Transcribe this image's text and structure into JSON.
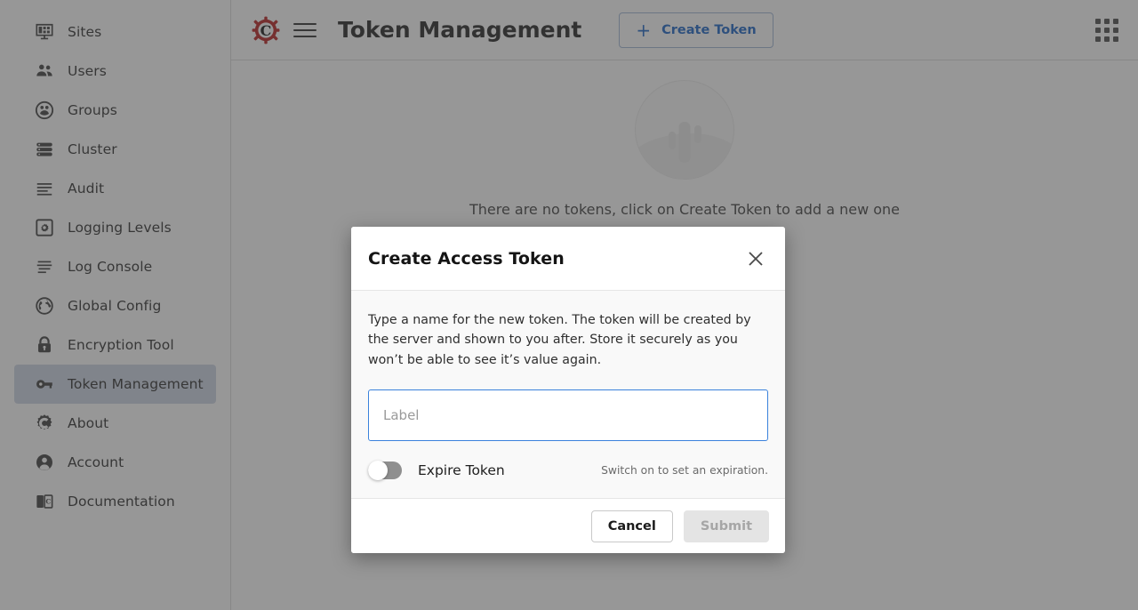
{
  "sidebar": {
    "items": [
      {
        "label": "Sites",
        "icon": "monitor-icon",
        "active": false
      },
      {
        "label": "Users",
        "icon": "users-icon",
        "active": false
      },
      {
        "label": "Groups",
        "icon": "groups-icon",
        "active": false
      },
      {
        "label": "Cluster",
        "icon": "server-stack-icon",
        "active": false
      },
      {
        "label": "Audit",
        "icon": "lines-icon",
        "active": false
      },
      {
        "label": "Logging Levels",
        "icon": "gear-square-icon",
        "active": false
      },
      {
        "label": "Log Console",
        "icon": "console-lines-icon",
        "active": false
      },
      {
        "label": "Global Config",
        "icon": "globe-icon",
        "active": false
      },
      {
        "label": "Encryption Tool",
        "icon": "lock-icon",
        "active": false
      },
      {
        "label": "Token Management",
        "icon": "key-icon",
        "active": true
      },
      {
        "label": "About",
        "icon": "gear-c-icon",
        "active": false
      },
      {
        "label": "Account",
        "icon": "person-icon",
        "active": false
      },
      {
        "label": "Documentation",
        "icon": "book-icon",
        "active": false
      }
    ]
  },
  "topbar": {
    "logo_icon": "gear-c-logo",
    "menu_icon": "hamburger-icon",
    "title": "Token Management",
    "create_button_label": "Create Token",
    "create_button_icon": "plus-icon",
    "launcher_icon": "grid-apps-icon",
    "accent_color": "#1862c6"
  },
  "empty_state": {
    "illustration": "desert-cactus-illustration",
    "message": "There are no tokens, click on Create Token to add a new one"
  },
  "dialog": {
    "title": "Create Access Token",
    "close_icon": "close-icon",
    "description": "Type a name for the new token. The token will be created by the server and shown to you after. Store it securely as you won’t be able to see it’s value again.",
    "label_input": {
      "value": "",
      "placeholder": "Label"
    },
    "expire_toggle": {
      "label": "Expire Token",
      "state": "off",
      "hint": "Switch on to set an expiration."
    },
    "cancel_label": "Cancel",
    "submit_label": "Submit",
    "submit_disabled": true,
    "focus_color": "#3b82dc"
  }
}
